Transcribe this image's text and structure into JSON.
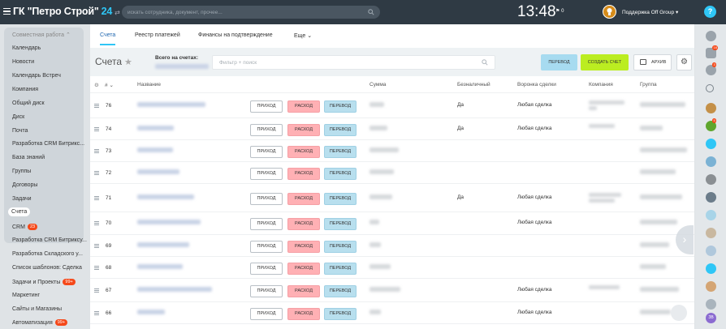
{
  "header": {
    "company": "ГК \"Петро Строй\"",
    "company_num": "24",
    "swap_icon": "⇄",
    "search_placeholder": "искать сотрудника, документ, прочее...",
    "time": "13:48",
    "flag_count": "0",
    "user_name": "Поддержка Off Group ▾",
    "help_label": "?"
  },
  "sidebar": {
    "group_title": "Совместная работа ⌃",
    "items": [
      {
        "label": "Календарь"
      },
      {
        "label": "Новости"
      },
      {
        "label": "Календарь Встреч"
      },
      {
        "label": "Компания"
      },
      {
        "label": "Общий диск"
      },
      {
        "label": "Диск"
      },
      {
        "label": "Почта"
      },
      {
        "label": "Разработка CRM Битрикс..."
      },
      {
        "label": "База знаний"
      },
      {
        "label": "Группы"
      },
      {
        "label": "Договоры"
      },
      {
        "label": "Задачи"
      },
      {
        "label": "Счета"
      },
      {
        "label": "CRM",
        "badge": "23"
      },
      {
        "label": "Разработка CRM Битриксу..."
      },
      {
        "label": "Разработка Складского у..."
      },
      {
        "label": "Список шаблонов: Сделка"
      },
      {
        "label": "Задачи и Проекты",
        "badge": "99+"
      },
      {
        "label": "Маркетинг"
      },
      {
        "label": "Сайты и Магазины"
      },
      {
        "label": "Автоматизация",
        "badge": "99+"
      }
    ]
  },
  "tabs": [
    {
      "label": "Счета"
    },
    {
      "label": "Реестр платежей"
    },
    {
      "label": "Финансы на подтверждение"
    },
    {
      "label": "Еще ⌄"
    }
  ],
  "toolbar": {
    "title": "Счета",
    "star": "★",
    "totals_label": "Всего на счетах:",
    "filter_placeholder": "Фильтр + поиск",
    "transfer_label": "ПЕРЕВОД",
    "create_label": "СОЗДАТЬ СЧЕТ",
    "archive_label": "АРХИВ",
    "settings_glyph": "⚙"
  },
  "table": {
    "settings_glyph": "⚙",
    "columns": [
      "#",
      "Название",
      "Сумма",
      "Безналичный",
      "Воронка сделки",
      "Компания",
      "Группа"
    ],
    "sort_glyph": "⌄",
    "action_labels": {
      "income": "ПРИХОД",
      "expense": "РАСХОД",
      "transfer": "ПЕРЕВОД"
    },
    "rows": [
      {
        "id": "76",
        "cashless": "Да",
        "funnel": "Любая сделка"
      },
      {
        "id": "74",
        "cashless": "Да",
        "funnel": "Любая сделка"
      },
      {
        "id": "73",
        "cashless": "",
        "funnel": ""
      },
      {
        "id": "72",
        "cashless": "",
        "funnel": ""
      },
      {
        "id": "71",
        "cashless": "Да",
        "funnel": "Любая сделка"
      },
      {
        "id": "70",
        "cashless": "",
        "funnel": "Любая сделка"
      },
      {
        "id": "69",
        "cashless": "",
        "funnel": ""
      },
      {
        "id": "68",
        "cashless": "",
        "funnel": ""
      },
      {
        "id": "67",
        "cashless": "",
        "funnel": "Любая сделка"
      },
      {
        "id": "66",
        "cashless": "",
        "funnel": "Любая сделка"
      }
    ]
  },
  "right_panel": {
    "badges": {
      "notifications": "16",
      "chat": "3",
      "widget": "5"
    },
    "last_avatar": "ЗВ"
  },
  "colors": {
    "header_bg": "#2f3a44",
    "accent": "#2fc6f6",
    "create_button": "#bbed21",
    "expense_button": "#ffb0b4",
    "transfer_button": "#b8dfee",
    "badge": "#f54819"
  }
}
